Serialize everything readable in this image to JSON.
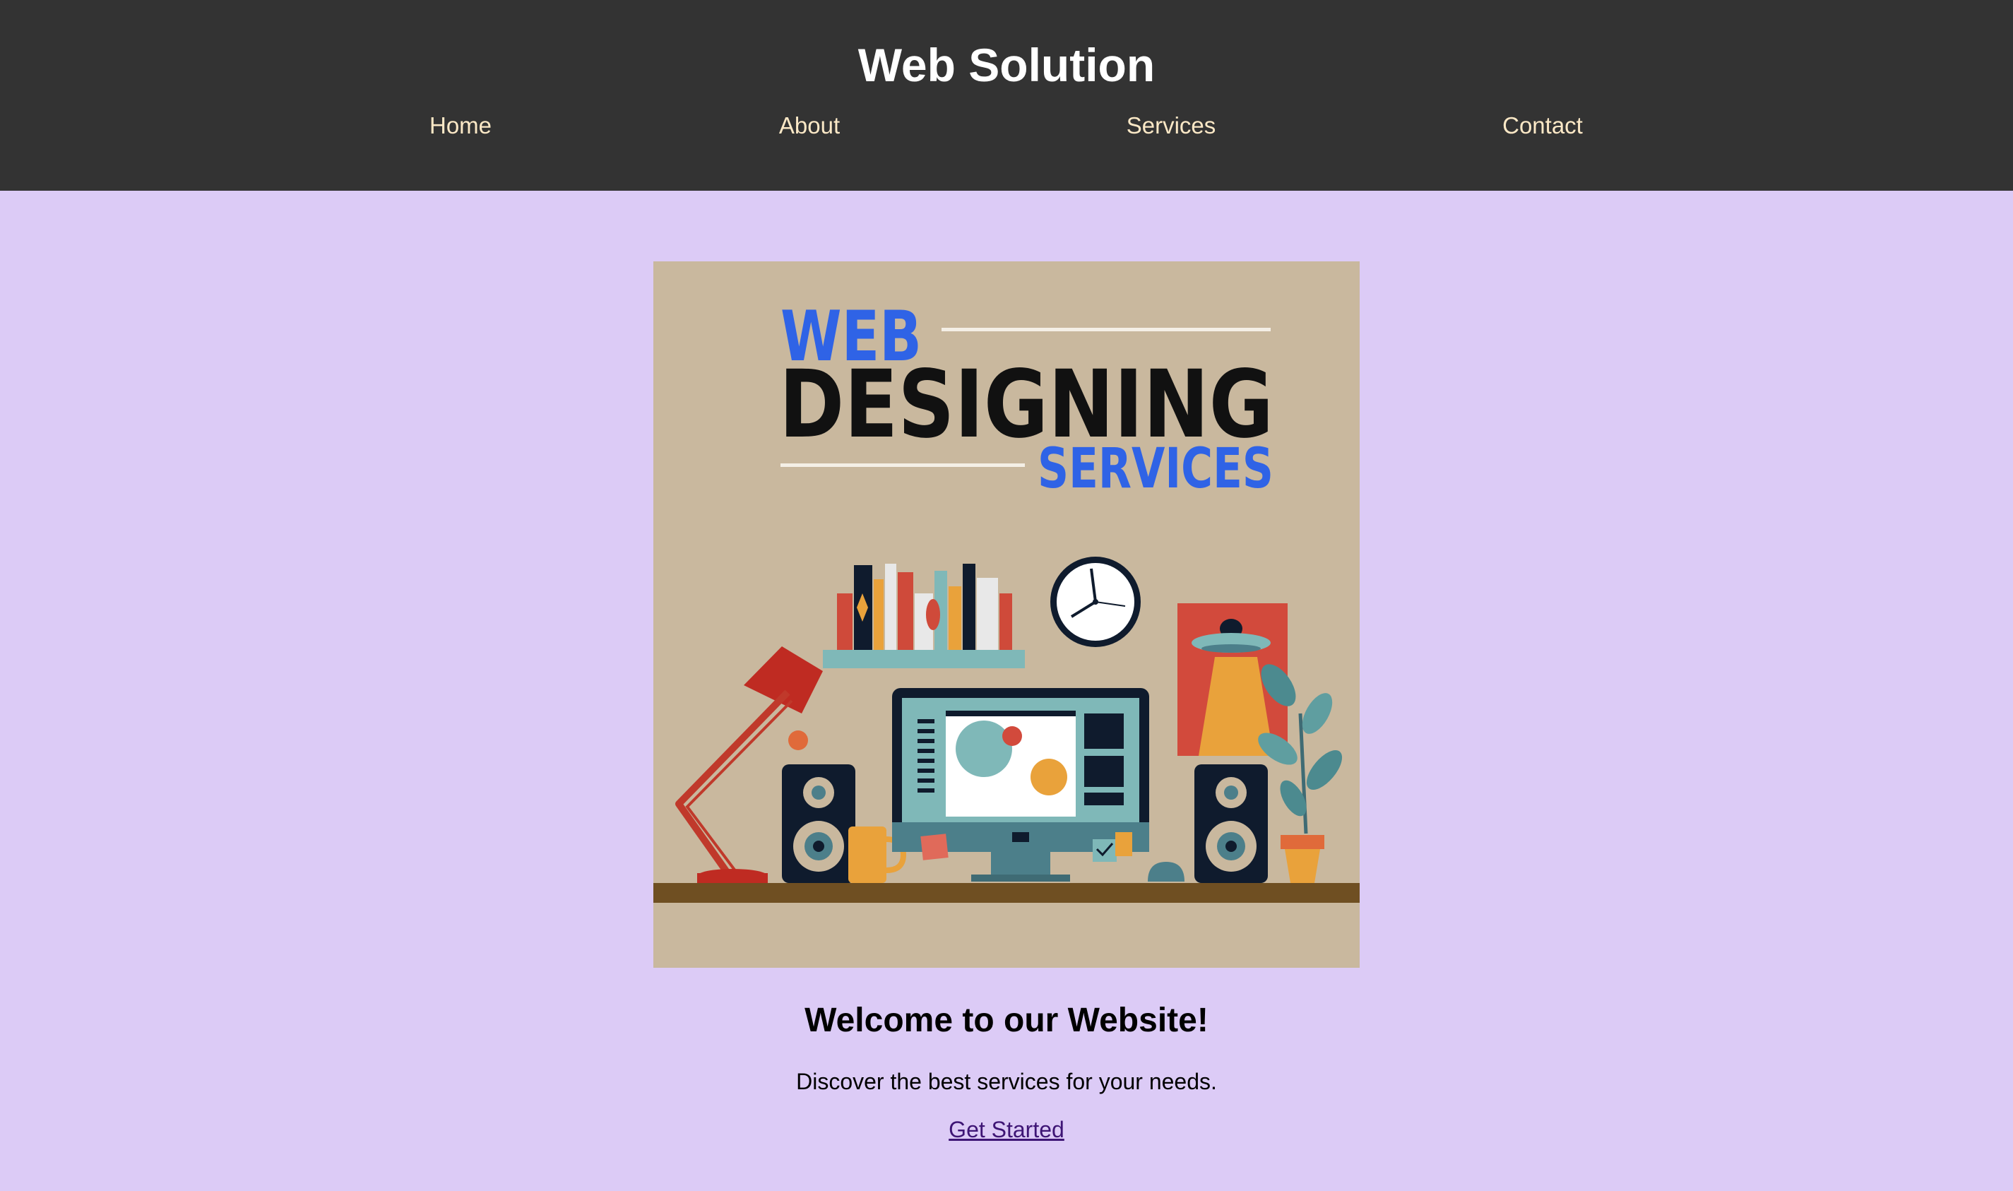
{
  "header": {
    "title": "Web Solution",
    "nav": [
      {
        "label": "Home"
      },
      {
        "label": "About"
      },
      {
        "label": "Services"
      },
      {
        "label": "Contact"
      }
    ]
  },
  "hero": {
    "image": {
      "word_web": "WEB",
      "word_designing": "DESIGNING",
      "word_services": "SERVICES"
    },
    "heading": "Welcome to our Website!",
    "text": "Discover the best services for your needs.",
    "cta_label": "Get Started"
  },
  "colors": {
    "header_bg": "#333333",
    "page_bg": "#dccbf6",
    "nav_text": "#fbe8c6",
    "cta_link": "#3e1575",
    "image_bg": "#c9b89e",
    "accent_blue": "#2f63e6"
  }
}
